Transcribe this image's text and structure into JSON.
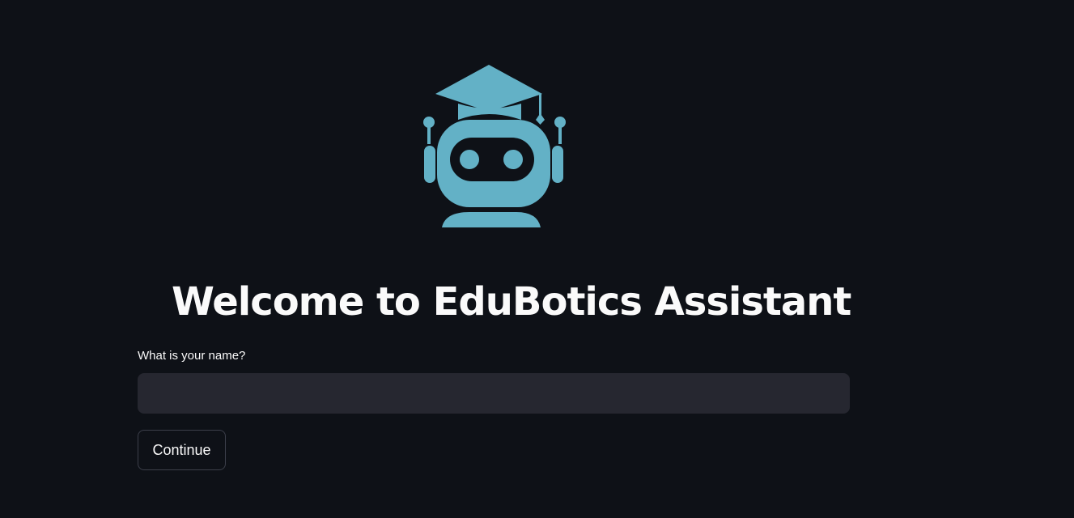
{
  "logo": {
    "icon": "graduate-robot-icon",
    "color": "#63b1c6"
  },
  "welcome": {
    "title": "Welcome to EduBotics Assistant"
  },
  "form": {
    "name_label": "What is your name?",
    "name_value": "",
    "name_placeholder": "",
    "continue_label": "Continue"
  },
  "colors": {
    "background": "#0e1117",
    "input_background": "#262730",
    "text": "#fafafa",
    "accent": "#63b1c6"
  }
}
